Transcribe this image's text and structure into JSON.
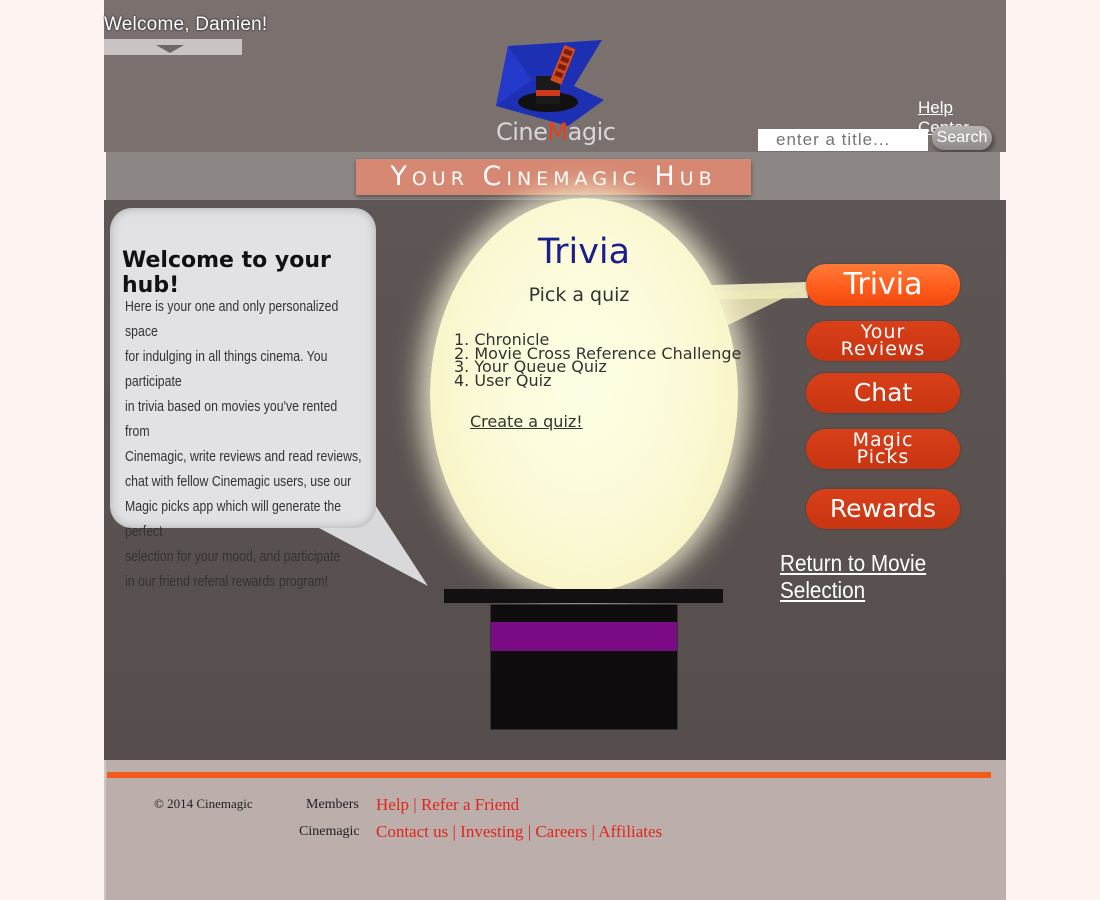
{
  "header": {
    "welcome": "Welcome,  Damien!",
    "logo_text_pre": "Cine",
    "logo_text_m": "M",
    "logo_text_post": "agic",
    "help_center": "Help  Center",
    "search_placeholder": "enter a title...",
    "search_button": "Search",
    "hub_title": "Your Cinemagic Hub"
  },
  "welcome_bubble": {
    "heading": "Welcome to your hub!",
    "lines": [
      "Here is your one and only personalized space",
      "for indulging in all things cinema. You participate",
      "in trivia based on movies you've rented from",
      "Cinemagic, write reviews and read reviews,",
      "chat with fellow Cinemagic users, use our",
      "Magic picks app which will generate the perfect",
      "selection for your mood, and participate",
      "in our friend referal rewards program!"
    ]
  },
  "trivia": {
    "title": "Trivia",
    "subtitle": "Pick a quiz",
    "quizzes": [
      "1. Chronicle",
      "2. Movie Cross Reference Challenge",
      "3. Your Queue Quiz",
      "4. User Quiz"
    ],
    "create_link": "Create a quiz!"
  },
  "nav": {
    "trivia": "Trivia",
    "reviews_line1": "Your",
    "reviews_line2": "Reviews",
    "chat": "Chat",
    "magic_line1": "Magic",
    "magic_line2": "Picks",
    "rewards": "Rewards",
    "return": "Return to Movie Selection"
  },
  "footer": {
    "copyright": "© 2014 Cinemagic",
    "members_label": "Members",
    "members_link1": "Help",
    "members_link2": "Refer a Friend",
    "cinemagic_label": "Cinemagic",
    "cinemagic_link1": "Contact us",
    "cinemagic_link2": "Investing",
    "cinemagic_link3": "Careers",
    "cinemagic_link4": "Affiliates",
    "separator": " | "
  },
  "colors": {
    "accent_orange": "#f15a18",
    "button_red": "#c83411",
    "hat_band": "#7b0a85",
    "trivia_blue": "#1a1e8f"
  }
}
